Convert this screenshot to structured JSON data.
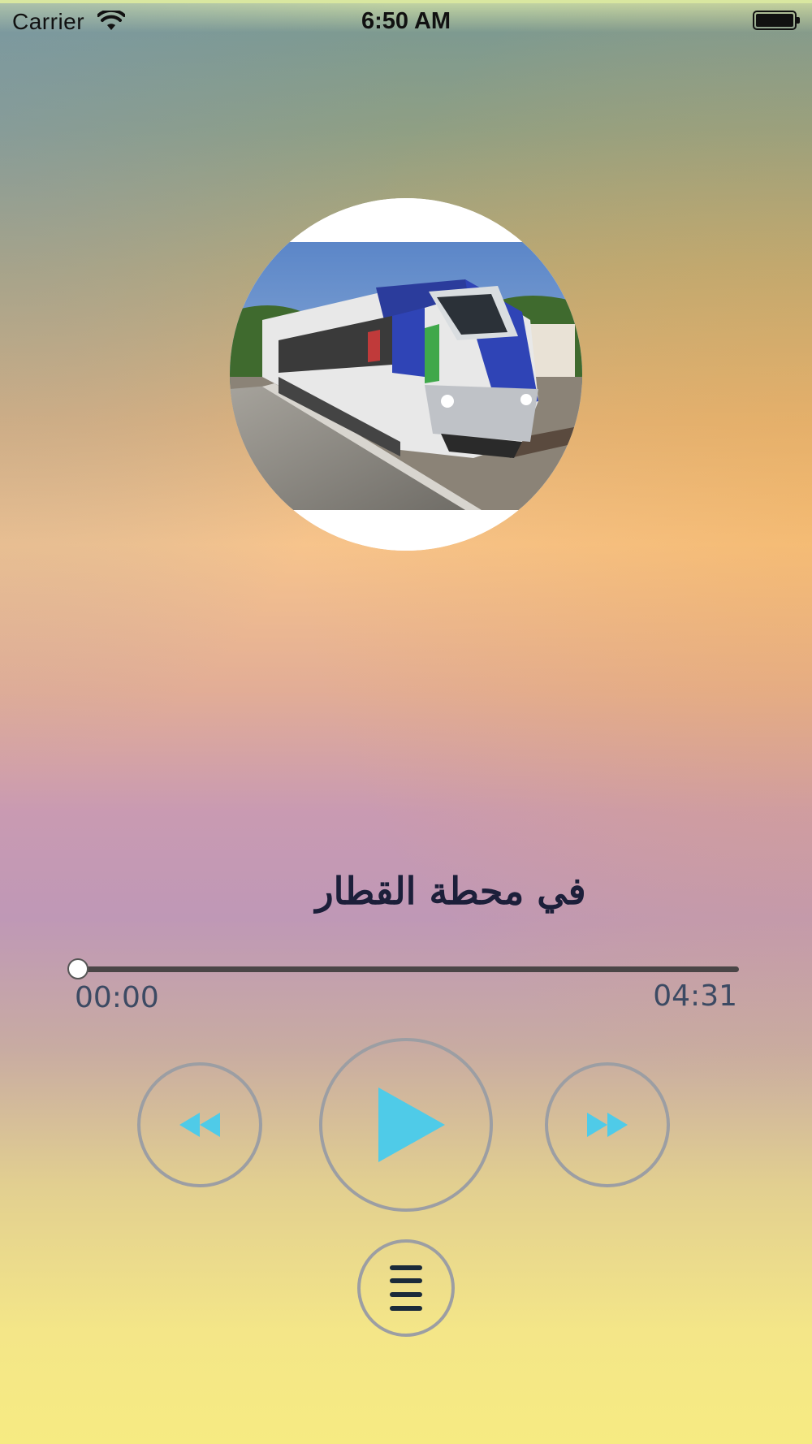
{
  "status_bar": {
    "carrier": "Carrier",
    "time": "6:50 AM"
  },
  "track": {
    "title": "في محطة القطار",
    "elapsed": "00:00",
    "duration": "04:31",
    "progress_fraction": 0
  },
  "controls": {
    "rewind_icon": "rewind-icon",
    "play_icon": "play-icon",
    "forward_icon": "fast-forward-icon",
    "menu_icon": "list-menu-icon",
    "accent_color": "#4fcbe8",
    "ring_color": "#9c9ea3"
  }
}
